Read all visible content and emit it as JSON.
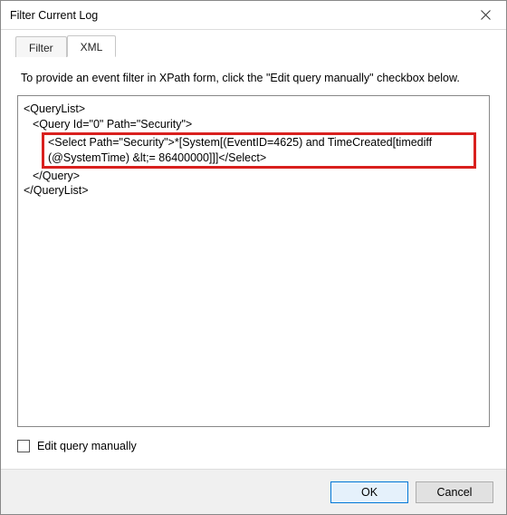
{
  "window": {
    "title": "Filter Current Log"
  },
  "tabs": {
    "filter": "Filter",
    "xml": "XML"
  },
  "instruction": "To provide an event filter in XPath form, click the \"Edit query manually\" checkbox below.",
  "xml": {
    "line1": "<QueryList>",
    "line2": "<Query Id=\"0\" Path=\"Security\">",
    "line3a": "<Select Path=\"Security\">*[System[(EventID=4625) and TimeCreated[timediff",
    "line3b": "(@SystemTime) &lt;= 86400000]]]</Select>",
    "line4": "</Query>",
    "line5": "</QueryList>"
  },
  "checkbox": {
    "edit_query_label": "Edit query manually",
    "checked": false
  },
  "buttons": {
    "ok": "OK",
    "cancel": "Cancel"
  }
}
